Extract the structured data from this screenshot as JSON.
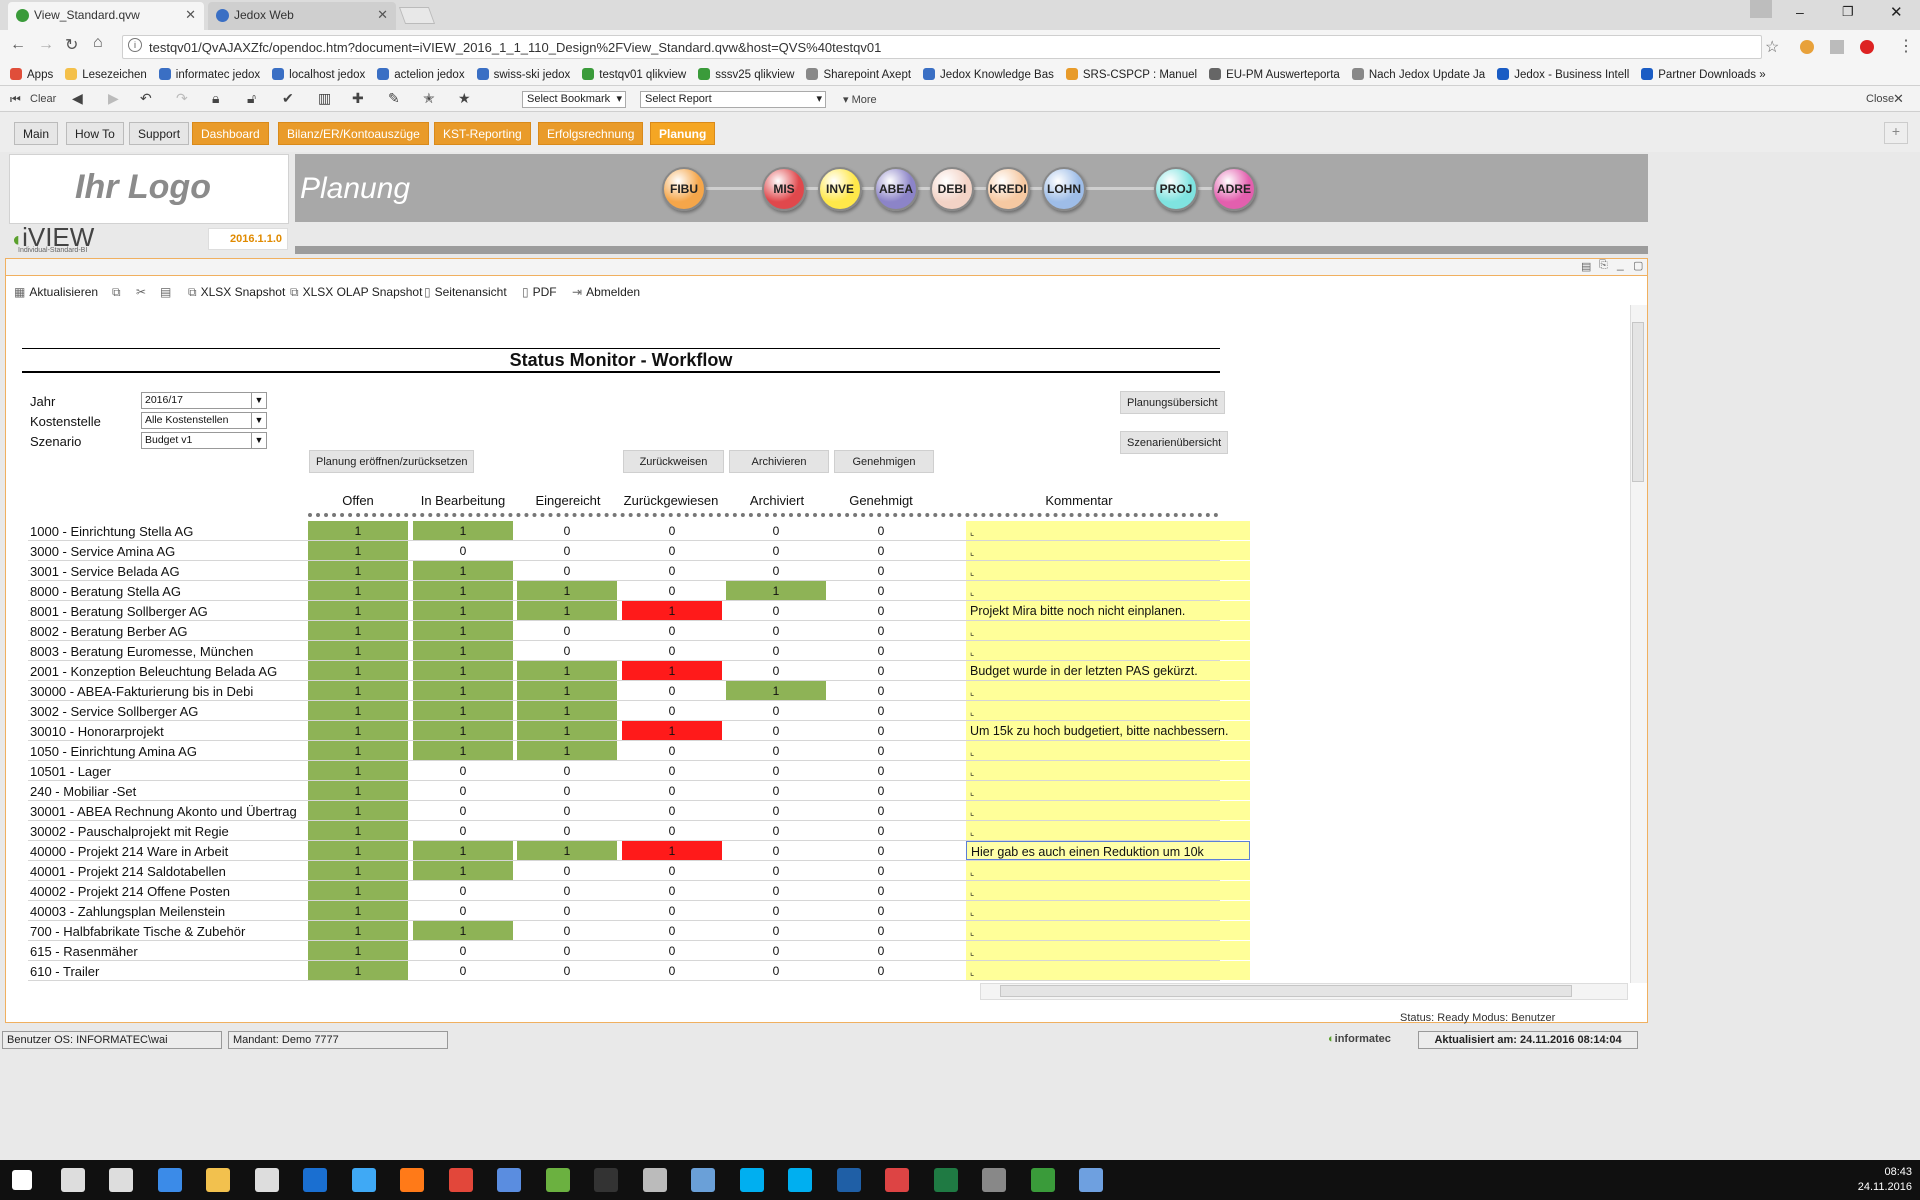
{
  "browser": {
    "tabs": [
      {
        "label": "View_Standard.qvw",
        "active": true
      },
      {
        "label": "Jedox Web",
        "active": false
      }
    ],
    "url": "testqv01/QvAJAXZfc/opendoc.htm?document=iVIEW_2016_1_1_110_Design%2FView_Standard.qvw&host=QVS%40testqv01",
    "bookmarks": [
      "Apps",
      "Lesezeichen",
      "informatec jedox",
      "localhost jedox",
      "actelion jedox",
      "swiss-ski jedox",
      "testqv01 qlikview",
      "sssv25 qlikview",
      "Sharepoint Axept",
      "Jedox Knowledge Bas",
      "SRS-CSPCP : Manuel",
      "EU-PM Auswerteporta",
      "Nach Jedox Update Ja",
      "Jedox - Business Intell",
      "Partner Downloads »"
    ]
  },
  "qvtoolbar": {
    "clear_label": "Clear",
    "bookmark_select": "Select Bookmark",
    "report_select": "Select Report",
    "more_label": "More",
    "close_label": "Close"
  },
  "apptabs": [
    {
      "label": "Main",
      "style": "grey"
    },
    {
      "label": "How To",
      "style": "grey"
    },
    {
      "label": "Support",
      "style": "grey"
    },
    {
      "label": "Dashboard",
      "style": "orange"
    },
    {
      "label": "Bilanz/ER/Kontoauszüge",
      "style": "orange"
    },
    {
      "label": "KST-Reporting",
      "style": "orange"
    },
    {
      "label": "Erfolgsrechnung",
      "style": "orange"
    },
    {
      "label": "Planung",
      "style": "active"
    }
  ],
  "header": {
    "logo_text": "Ihr Logo",
    "brand": "iVIEW",
    "brand_sub": "Individual-Standard-BI",
    "version": "2016.1.1.0",
    "page_title": "Planung",
    "modules": [
      {
        "label": "FIBU",
        "color": "#f5a64a"
      },
      {
        "label": "MIS",
        "color": "#e0484c"
      },
      {
        "label": "INVE",
        "color": "#ffe84a"
      },
      {
        "label": "ABEA",
        "color": "#8c84c8"
      },
      {
        "label": "DEBI",
        "color": "#f3d3c6"
      },
      {
        "label": "KREDI",
        "color": "#f6c9a2"
      },
      {
        "label": "LOHN",
        "color": "#9ebde8"
      },
      {
        "label": "PROJ",
        "color": "#7fe3e0"
      },
      {
        "label": "ADRE",
        "color": "#e35fae"
      }
    ]
  },
  "content_toolbar": [
    "Aktualisieren",
    "XLSX Snapshot",
    "XLSX OLAP Snapshot",
    "Seitenansicht",
    "PDF",
    "Abmelden"
  ],
  "monitor": {
    "title": "Status Monitor - Workflow",
    "filters": [
      {
        "label": "Jahr",
        "value": "2016/17"
      },
      {
        "label": "Kostenstelle",
        "value": "Alle Kostenstellen"
      },
      {
        "label": "Szenario",
        "value": "Budget v1"
      }
    ],
    "buttons": {
      "open_reset": "Planung eröffnen/zurücksetzen",
      "reject": "Zurückweisen",
      "archive": "Archivieren",
      "approve": "Genehmigen",
      "plan_overview": "Planungsübersicht",
      "scenario_overview": "Szenarienübersicht"
    },
    "columns": [
      "Offen",
      "In Bearbeitung",
      "Eingereicht",
      "Zurückgewiesen",
      "Archiviert",
      "Genehmigt",
      "Kommentar"
    ],
    "rows": [
      {
        "name": "1000 - Einrichtung Stella AG",
        "v": [
          1,
          1,
          0,
          0,
          0,
          0
        ],
        "c": ""
      },
      {
        "name": "3000 - Service Amina AG",
        "v": [
          1,
          0,
          0,
          0,
          0,
          0
        ],
        "c": ""
      },
      {
        "name": "3001 - Service Belada AG",
        "v": [
          1,
          1,
          0,
          0,
          0,
          0
        ],
        "c": ""
      },
      {
        "name": "8000 - Beratung Stella AG",
        "v": [
          1,
          1,
          1,
          0,
          1,
          0
        ],
        "c": ""
      },
      {
        "name": "8001 - Beratung Sollberger AG",
        "v": [
          1,
          1,
          1,
          1,
          0,
          0
        ],
        "c": "Projekt Mira bitte noch nicht einplanen."
      },
      {
        "name": "8002 - Beratung Berber AG",
        "v": [
          1,
          1,
          0,
          0,
          0,
          0
        ],
        "c": ""
      },
      {
        "name": "8003 - Beratung Euromesse, München",
        "v": [
          1,
          1,
          0,
          0,
          0,
          0
        ],
        "c": ""
      },
      {
        "name": "2001 - Konzeption Beleuchtung Belada AG",
        "v": [
          1,
          1,
          1,
          1,
          0,
          0
        ],
        "c": "Budget wurde in der letzten PAS gekürzt."
      },
      {
        "name": "30000 - ABEA-Fakturierung bis in Debi",
        "v": [
          1,
          1,
          1,
          0,
          1,
          0
        ],
        "c": ""
      },
      {
        "name": "3002 - Service Sollberger AG",
        "v": [
          1,
          1,
          1,
          0,
          0,
          0
        ],
        "c": ""
      },
      {
        "name": "30010 - Honorarprojekt",
        "v": [
          1,
          1,
          1,
          1,
          0,
          0
        ],
        "c": "Um 15k zu hoch budgetiert, bitte nachbessern."
      },
      {
        "name": "1050 - Einrichtung Amina AG",
        "v": [
          1,
          1,
          1,
          0,
          0,
          0
        ],
        "c": ""
      },
      {
        "name": "10501 - Lager",
        "v": [
          1,
          0,
          0,
          0,
          0,
          0
        ],
        "c": ""
      },
      {
        "name": "240 - Mobiliar -Set",
        "v": [
          1,
          0,
          0,
          0,
          0,
          0
        ],
        "c": ""
      },
      {
        "name": "30001 - ABEA Rechnung Akonto und Übertrag",
        "v": [
          1,
          0,
          0,
          0,
          0,
          0
        ],
        "c": ""
      },
      {
        "name": "30002 - Pauschalprojekt mit Regie",
        "v": [
          1,
          0,
          0,
          0,
          0,
          0
        ],
        "c": ""
      },
      {
        "name": "40000 - Projekt 214 Ware in Arbeit",
        "v": [
          1,
          1,
          1,
          1,
          0,
          0
        ],
        "c": "Hier gab es auch einen Reduktion um 10k",
        "selected": true
      },
      {
        "name": "40001 - Projekt 214 Saldotabellen",
        "v": [
          1,
          1,
          0,
          0,
          0,
          0
        ],
        "c": ""
      },
      {
        "name": "40002 - Projekt 214 Offene Posten",
        "v": [
          1,
          0,
          0,
          0,
          0,
          0
        ],
        "c": ""
      },
      {
        "name": "40003 - Zahlungsplan Meilenstein",
        "v": [
          1,
          0,
          0,
          0,
          0,
          0
        ],
        "c": ""
      },
      {
        "name": "700 - Halbfabrikate Tische & Zubehör",
        "v": [
          1,
          1,
          0,
          0,
          0,
          0
        ],
        "c": ""
      },
      {
        "name": "615 - Rasenmäher",
        "v": [
          1,
          0,
          0,
          0,
          0,
          0
        ],
        "c": ""
      },
      {
        "name": "610 - Trailer",
        "v": [
          1,
          0,
          0,
          0,
          0,
          0
        ],
        "c": ""
      }
    ],
    "status_text": "Status:  Ready        Modus:  Benutzer"
  },
  "statusbar": {
    "user": "Benutzer OS: INFORMATEC\\wai",
    "mandant": "Mandant: Demo 7777",
    "brand": "informatec",
    "updated": "Aktualisiert am: 24.11.2016 08:14:04"
  },
  "taskbar": {
    "time": "08:43",
    "date": "24.11.2016"
  }
}
